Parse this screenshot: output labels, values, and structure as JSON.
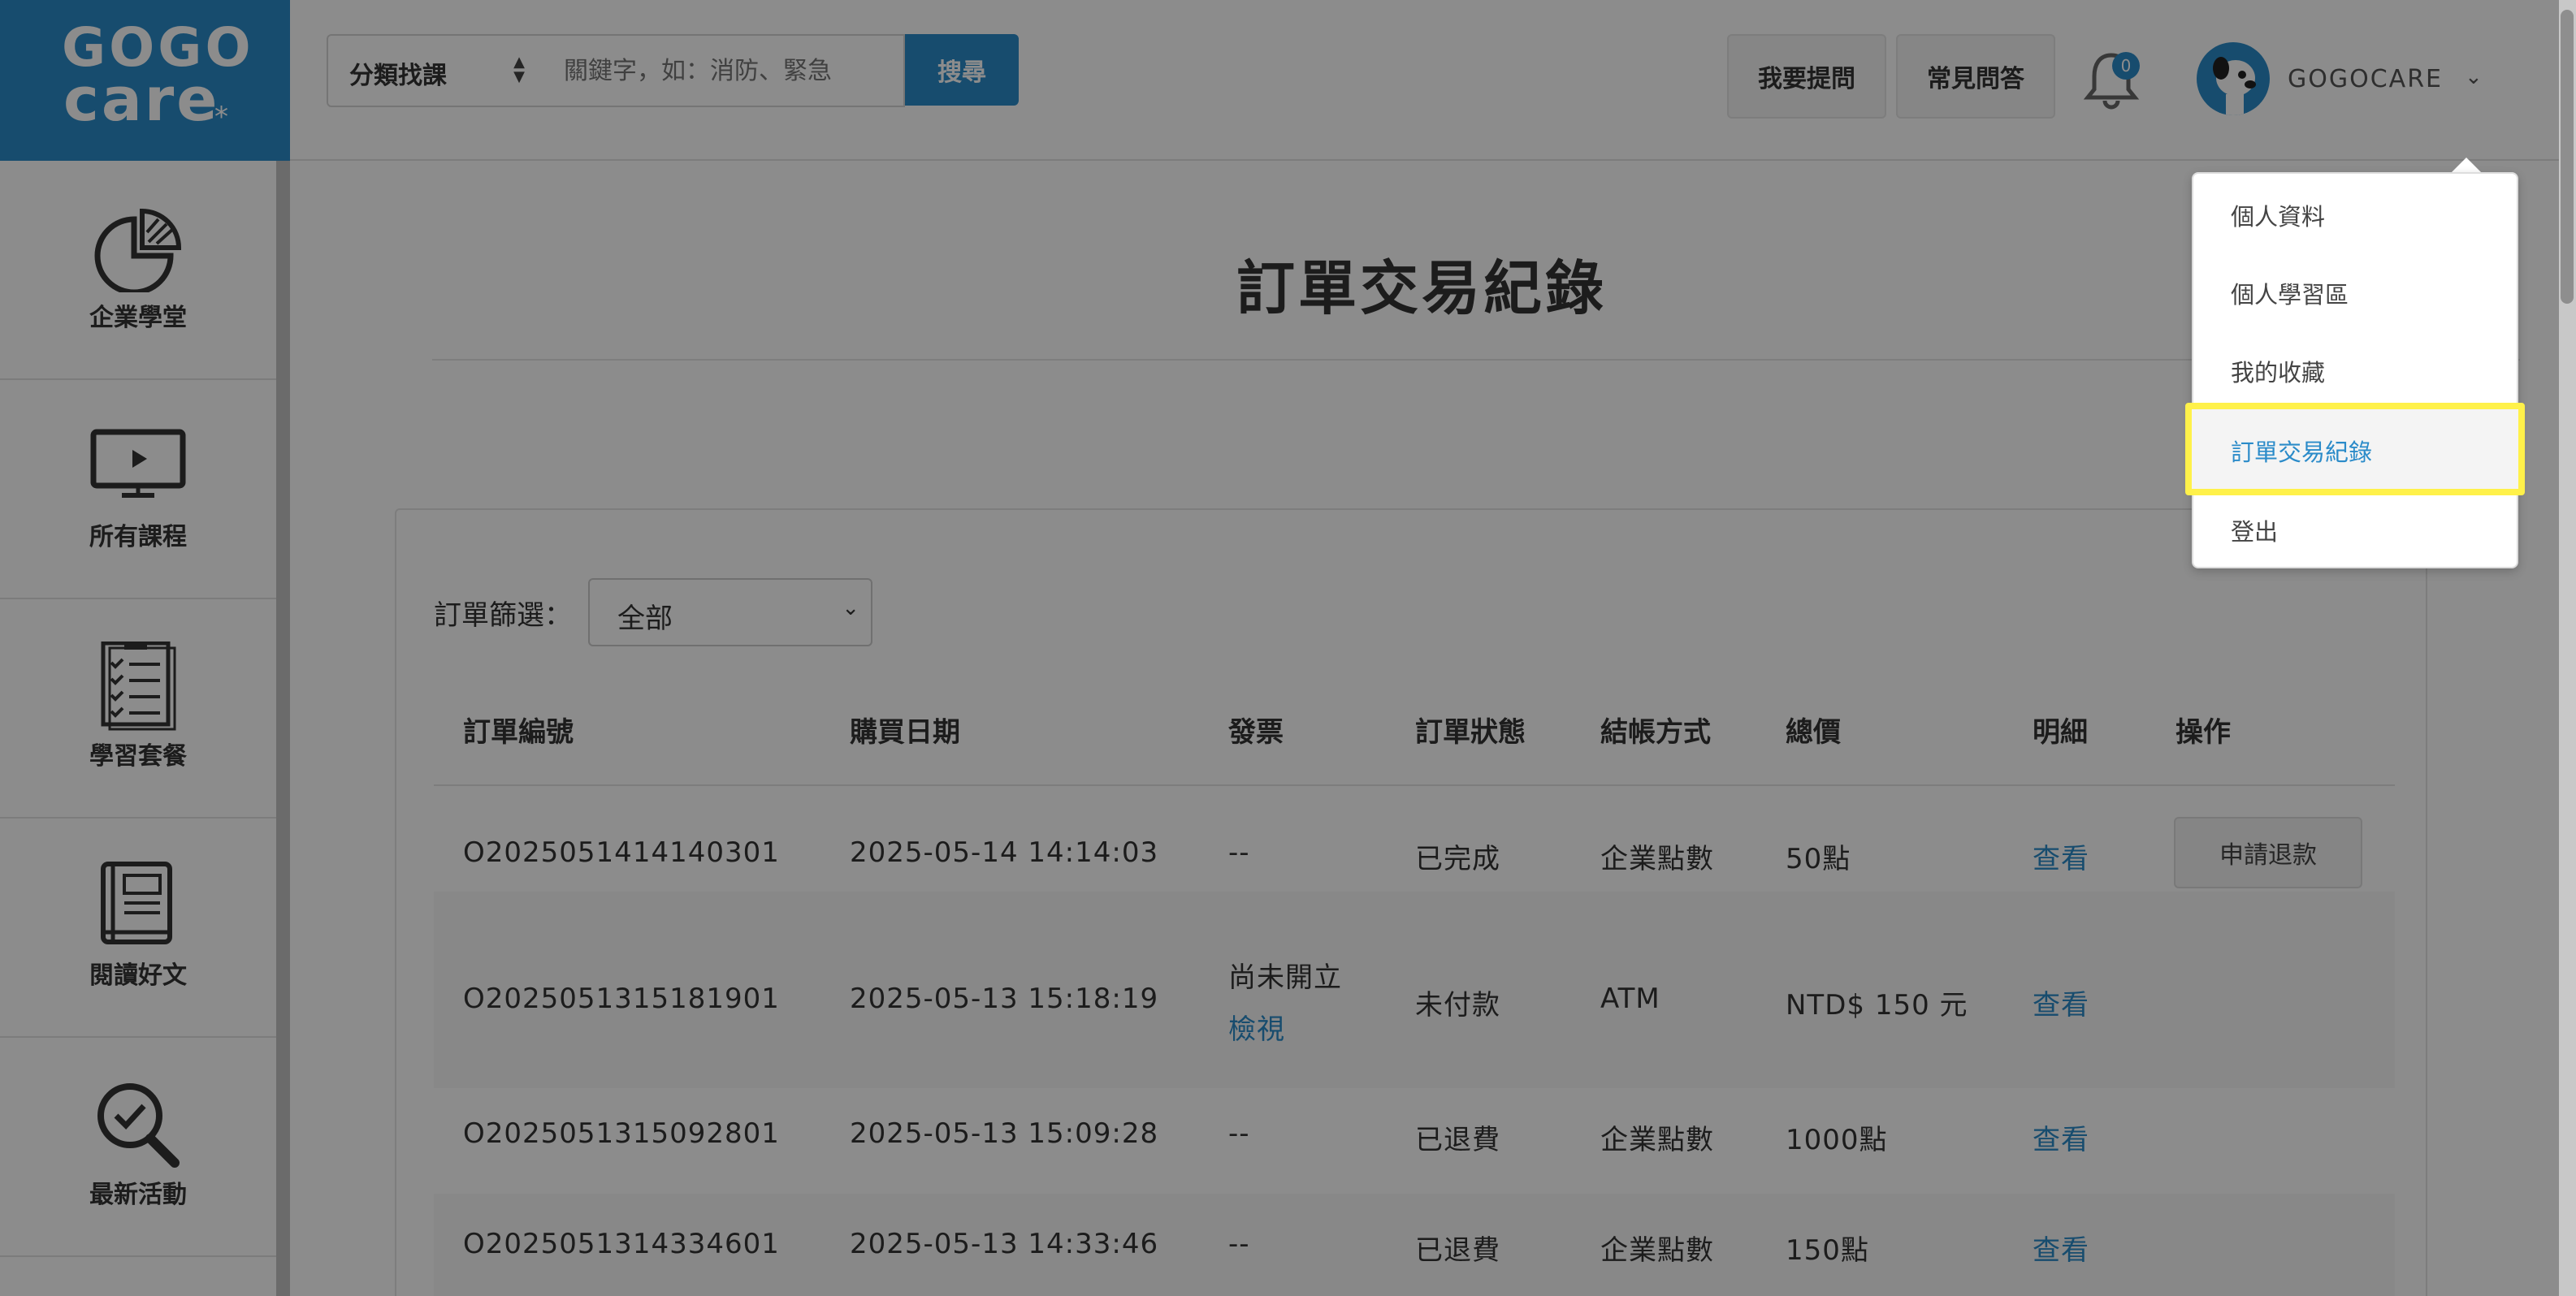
{
  "logo": {
    "line1": "GOGO",
    "line2": "care",
    "star": "*"
  },
  "sidebar": {
    "items": [
      {
        "label": "企業學堂",
        "icon": "pie-chart-icon"
      },
      {
        "label": "所有課程",
        "icon": "tv-play-icon"
      },
      {
        "label": "學習套餐",
        "icon": "checklist-icon"
      },
      {
        "label": "閱讀好文",
        "icon": "book-icon"
      },
      {
        "label": "最新活動",
        "icon": "magnifier-check-icon"
      }
    ]
  },
  "header": {
    "category_select": "分類找課",
    "search_placeholder": "關鍵字，如：消防、緊急",
    "search_button": "搜尋",
    "ask_button": "我要提問",
    "faq_button": "常見問答",
    "notification_count": "0",
    "username": "GOGOCARE"
  },
  "user_menu": {
    "items": [
      "個人資料",
      "個人學習區",
      "我的收藏",
      "訂單交易紀錄",
      "登出"
    ],
    "highlighted": "訂單交易紀錄"
  },
  "main": {
    "title": "訂單交易紀錄",
    "filter_label": "訂單篩選：",
    "filter_value": "全部",
    "columns": [
      "訂單編號",
      "購買日期",
      "發票",
      "訂單狀態",
      "結帳方式",
      "總價",
      "明細",
      "操作"
    ],
    "rows": [
      {
        "order_no": "O2025051414140301",
        "date": "2025-05-14 14:14:03",
        "invoice": "--",
        "invoice_link": "",
        "status": "已完成",
        "payment": "企業點數",
        "total": "50點",
        "detail": "查看",
        "action": "申請退款"
      },
      {
        "order_no": "O2025051315181901",
        "date": "2025-05-13 15:18:19",
        "invoice": "尚未開立",
        "invoice_link": "檢視",
        "status": "未付款",
        "payment": "ATM",
        "total": "NTD$ 150 元",
        "detail": "查看",
        "action": ""
      },
      {
        "order_no": "O2025051315092801",
        "date": "2025-05-13 15:09:28",
        "invoice": "--",
        "invoice_link": "",
        "status": "已退費",
        "payment": "企業點數",
        "total": "1000點",
        "detail": "查看",
        "action": ""
      },
      {
        "order_no": "O2025051314334601",
        "date": "2025-05-13 14:33:46",
        "invoice": "--",
        "invoice_link": "",
        "status": "已退費",
        "payment": "企業點數",
        "total": "150點",
        "detail": "查看",
        "action": ""
      }
    ]
  },
  "colors": {
    "brand": "#2b8bc9",
    "highlight": "#fff14a"
  }
}
